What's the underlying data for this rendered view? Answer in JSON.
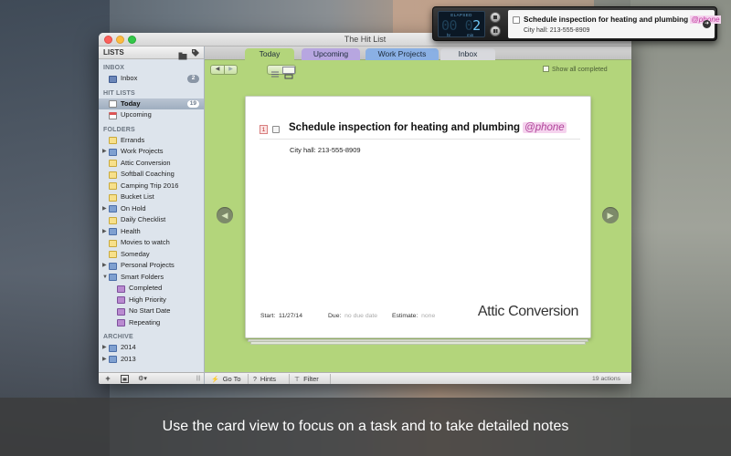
{
  "window": {
    "title": "The Hit List"
  },
  "sidebar": {
    "header": "LISTS",
    "tag_icon": "⌂",
    "sections": {
      "inbox": "INBOX",
      "hit_lists": "HIT LISTS",
      "folders": "FOLDERS",
      "archive": "ARCHIVE"
    },
    "inbox": {
      "label": "Inbox",
      "count": "2"
    },
    "today": {
      "label": "Today",
      "count": "19"
    },
    "upcoming": {
      "label": "Upcoming"
    },
    "folders": [
      {
        "label": "Errands"
      },
      {
        "label": "Work Projects"
      },
      {
        "label": "Attic Conversion"
      },
      {
        "label": "Softball Coaching"
      },
      {
        "label": "Camping Trip 2016"
      },
      {
        "label": "Bucket List"
      },
      {
        "label": "On Hold"
      },
      {
        "label": "Daily Checklist"
      },
      {
        "label": "Health"
      },
      {
        "label": "Movies to watch"
      },
      {
        "label": "Someday"
      },
      {
        "label": "Personal Projects"
      },
      {
        "label": "Smart Folders"
      },
      {
        "label": "Completed"
      },
      {
        "label": "High Priority"
      },
      {
        "label": "No Start Date"
      },
      {
        "label": "Repeating"
      }
    ],
    "archive": [
      {
        "label": "2014"
      },
      {
        "label": "2013"
      }
    ],
    "footer": {
      "add": "+",
      "gear": "⚙▾",
      "resize": "|||"
    }
  },
  "tabs": [
    {
      "label": "Today",
      "color": "#b3d57b"
    },
    {
      "label": "Upcoming",
      "color": "#b7a6e0"
    },
    {
      "label": "Work Projects",
      "color": "#8ab0e4"
    },
    {
      "label": "Inbox",
      "color": "#d8d9dd"
    }
  ],
  "toolbar": {
    "back": "◀",
    "forward": "▶",
    "show_all_completed": "Show all completed"
  },
  "card": {
    "priority": "1",
    "title": "Schedule inspection for heating and plumbing",
    "context": "@phone",
    "notes": "City hall:  213-555-8909",
    "start_label": "Start:",
    "start_value": "11/27/14",
    "due_label": "Due:",
    "due_value": "no due date",
    "estimate_label": "Estimate:",
    "estimate_value": "none",
    "folder": "Attic Conversion",
    "prev_arrow": "◀",
    "next_arrow": "▶"
  },
  "main_footer": {
    "goto_icon": "⚡",
    "goto": "Go To",
    "hints_icon": "?",
    "hints": "Hints",
    "filter_icon": "⊤",
    "filter": "Filter",
    "count": "19 actions"
  },
  "timer": {
    "label": "ELAPSED",
    "hours_dim": "00",
    "minutes_dim": "0",
    "minutes_on": "2",
    "hr_unit": "hr",
    "min_unit": "min",
    "task_title": "Schedule inspection for heating and plumbing",
    "task_context": "@phone",
    "task_note": "City hall: 213-555-8909",
    "go_icon": "➜"
  },
  "caption": "Use the card view to focus on a task and to take detailed notes",
  "colors": {
    "accent_green": "#b3d57b",
    "context_pink": "#c03a9e",
    "priority_red": "#c03030"
  }
}
